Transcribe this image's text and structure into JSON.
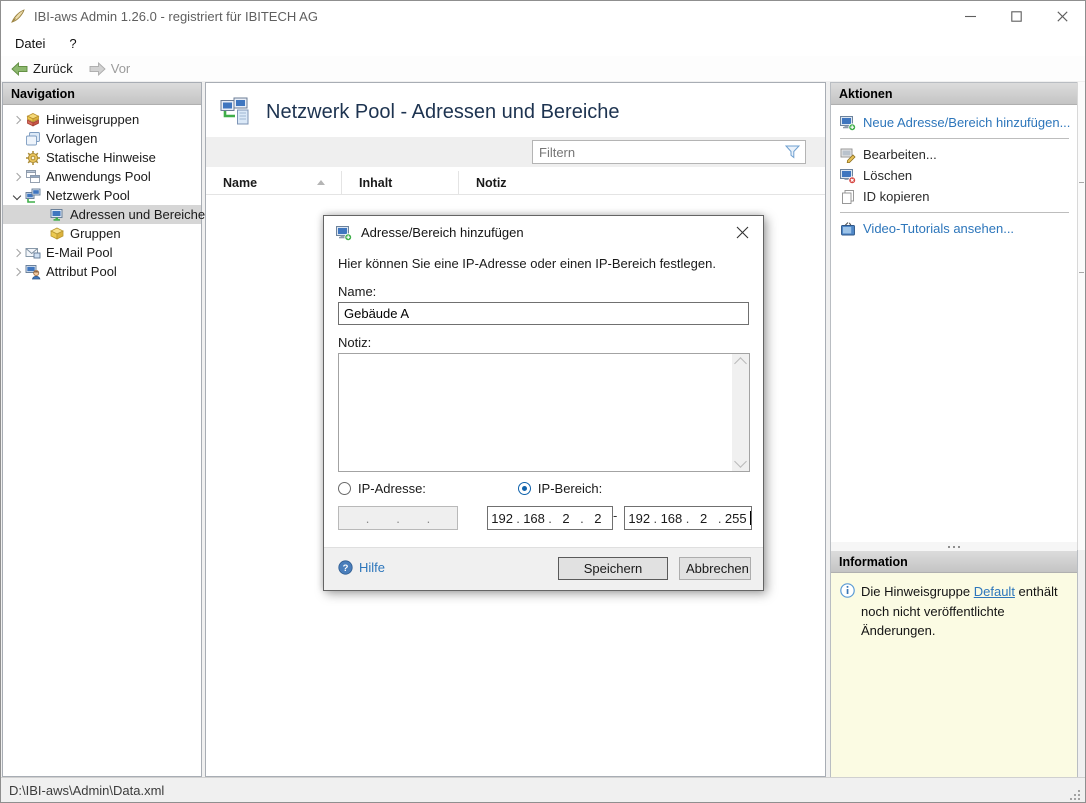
{
  "colors": {
    "accent_link": "#2d76bb",
    "heading_navy": "#1d3350",
    "nav_selection": "#d6d6d6",
    "panel_header_gray": "#c9c9c9",
    "info_panel_yellow": "#fbfbe3",
    "back_arrow_green": "#8db86f",
    "radio_selected_blue": "#0f62ac",
    "filter_funnel_blue": "#6fa0d0"
  },
  "window": {
    "title": "IBI-aws Admin 1.26.0 - registriert für IBITECH AG",
    "app_icon": "quill-icon",
    "controls": [
      "minimize",
      "maximize",
      "close"
    ]
  },
  "menubar": {
    "items": [
      "Datei",
      "?"
    ]
  },
  "toolbar": {
    "back_label": "Zurück",
    "forward_label": "Vor"
  },
  "navigation": {
    "header": "Navigation",
    "items": [
      {
        "label": "Hinweisgruppen",
        "icon": "notice-groups-icon",
        "expander": "collapsed",
        "level": 0,
        "selected": false
      },
      {
        "label": "Vorlagen",
        "icon": "templates-icon",
        "expander": "none",
        "level": 0,
        "selected": false
      },
      {
        "label": "Statische Hinweise",
        "icon": "static-notices-icon",
        "expander": "none",
        "level": 0,
        "selected": false
      },
      {
        "label": "Anwendungs Pool",
        "icon": "application-pool-icon",
        "expander": "collapsed",
        "level": 0,
        "selected": false
      },
      {
        "label": "Netzwerk Pool",
        "icon": "network-pool-icon",
        "expander": "expanded",
        "level": 0,
        "selected": false
      },
      {
        "label": "Adressen und Bereiche",
        "icon": "address-range-icon",
        "expander": "none",
        "level": 1,
        "selected": true
      },
      {
        "label": "Gruppen",
        "icon": "groups-icon",
        "expander": "none",
        "level": 1,
        "selected": false
      },
      {
        "label": "E-Mail Pool",
        "icon": "email-pool-icon",
        "expander": "collapsed",
        "level": 0,
        "selected": false
      },
      {
        "label": "Attribut Pool",
        "icon": "attribute-pool-icon",
        "expander": "collapsed",
        "level": 0,
        "selected": false
      }
    ]
  },
  "main": {
    "title": "Netzwerk Pool - Adressen und Bereiche",
    "title_icon": "network-pool-large-icon",
    "filter": {
      "placeholder": "Filtern",
      "icon": "filter-funnel-icon"
    },
    "table": {
      "columns": [
        "Name",
        "Inhalt",
        "Notiz"
      ],
      "sort": {
        "column": "Name",
        "direction": "ascending"
      },
      "rows": []
    }
  },
  "actions": {
    "header": "Aktionen",
    "items": [
      {
        "label": "Neue Adresse/Bereich hinzufügen...",
        "icon": "add-address-icon",
        "style": "link"
      },
      {
        "label": "Bearbeiten...",
        "icon": "edit-address-icon",
        "style": "normal"
      },
      {
        "label": "Löschen",
        "icon": "delete-address-icon",
        "style": "normal"
      },
      {
        "label": "ID kopieren",
        "icon": "copy-id-icon",
        "style": "normal"
      },
      {
        "label": "Video-Tutorials ansehen...",
        "icon": "video-tutorials-icon",
        "style": "link"
      }
    ]
  },
  "information": {
    "header": "Information",
    "message_before": "Die Hinweisgruppe ",
    "message_link": "Default",
    "message_after": " enthält noch nicht veröffentlichte Änderungen."
  },
  "dialog": {
    "title": "Adresse/Bereich hinzufügen",
    "title_icon": "add-address-icon",
    "description": "Hier können Sie eine IP-Adresse oder einen IP-Bereich festlegen.",
    "name_label": "Name:",
    "name_value": "Gebäude A",
    "note_label": "Notiz:",
    "note_value": "",
    "ip_address_label": "IP-Adresse:",
    "ip_range_label": "IP-Bereich:",
    "selected_option": "IP-Bereich",
    "octet_separator": ".",
    "range_separator": "-",
    "ip_single_octets": [
      "",
      "",
      "",
      ""
    ],
    "ip_range_start_octets": [
      "192",
      "168",
      "2",
      "2"
    ],
    "ip_range_end_octets": [
      "192",
      "168",
      "2",
      "255"
    ],
    "help_label": "Hilfe",
    "save_label": "Speichern",
    "cancel_label": "Abbrechen"
  },
  "statusbar": {
    "path": "D:\\IBI-aws\\Admin\\Data.xml"
  }
}
